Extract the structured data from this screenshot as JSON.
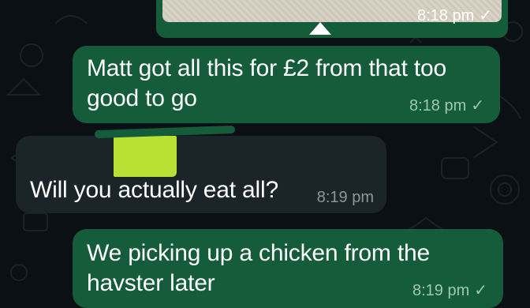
{
  "colors": {
    "background": "#0b1014",
    "outgoing_bubble": "#155c3b",
    "incoming_bubble": "#1b2429",
    "text": "#ffffff",
    "outgoing_time": "#9fc8b1",
    "incoming_time": "#8b979d",
    "quote_highlight": "#b9e034"
  },
  "messages": [
    {
      "direction": "outgoing",
      "type": "image",
      "time": "8:18 pm",
      "status_icon": "double-check-icon"
    },
    {
      "direction": "outgoing",
      "lines": [
        "Matt got all this for £2 from that too",
        "good to go"
      ],
      "time": "8:18 pm",
      "status_icon": "check-icon"
    },
    {
      "direction": "incoming",
      "lines": [
        "Will you actually eat all?"
      ],
      "time": "8:19 pm"
    },
    {
      "direction": "outgoing",
      "lines": [
        "We picking up a chicken from the",
        "havster later"
      ],
      "time": "8:19 pm",
      "status_icon": "check-icon"
    }
  ]
}
